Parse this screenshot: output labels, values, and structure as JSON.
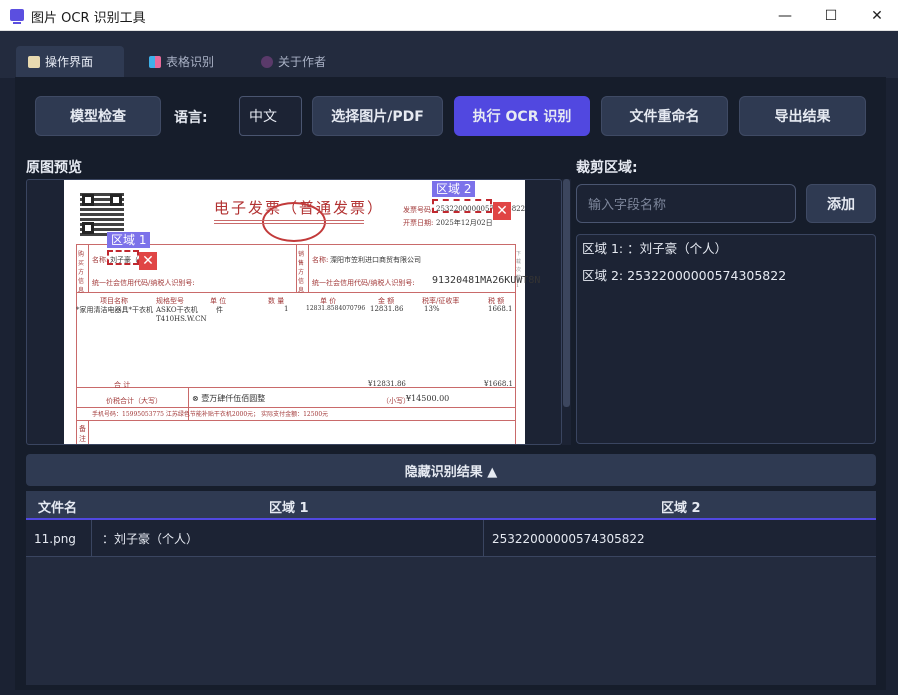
{
  "window": {
    "title": "图片 OCR 识别工具",
    "min": "—",
    "max": "☐",
    "close": "✕"
  },
  "tabs": [
    {
      "label": "操作界面",
      "icon": "clipboard-icon"
    },
    {
      "label": "表格识别",
      "icon": "table-icon"
    },
    {
      "label": "关于作者",
      "icon": "person-icon"
    }
  ],
  "toolbar": {
    "model_check": "模型检查",
    "lang_label": "语言:",
    "lang_value": "中文",
    "select_file": "选择图片/PDF",
    "run_ocr": "执行 OCR 识别",
    "rename": "文件重命名",
    "export": "导出结果"
  },
  "preview": {
    "label": "原图预览",
    "invoice": {
      "title": "电子发票（普通发票）",
      "invoice_no_label": "发票号码:",
      "invoice_no": "25322000000574305822",
      "date_label": "开票日期:",
      "date": "2025年12月02日",
      "buyer_name_label": "名称:",
      "buyer_name": "刘子豪（个人）",
      "buyer_tax_label": "统一社会信用代码/纳税人识别号:",
      "seller_name_label": "名称:",
      "seller_name": "溧阳市笠利进口商贸有限公司",
      "seller_tax_label": "统一社会信用代码/纳税人识别号:",
      "seller_tax": "91320481MA26KUWT8N",
      "buyer_side": "购买方信息",
      "seller_side": "销售方信息",
      "col_item": "项目名称",
      "col_spec": "规格型号",
      "col_unit": "单 位",
      "col_qty": "数 量",
      "col_price": "单 价",
      "col_amount": "金 额",
      "col_rate": "税率/征收率",
      "col_tax": "税 额",
      "item_name": "*家用清洁电器具*干衣机",
      "item_spec": "ASKO干衣机",
      "item_spec2": "T410HS.W.CN",
      "item_unit": "件",
      "item_qty": "1",
      "item_price": "12831.8584070796",
      "item_amount": "12831.86",
      "item_rate": "13%",
      "item_tax": "1668.1",
      "total_label": "合 计",
      "total_amount": "¥12831.86",
      "total_tax": "¥1668.1",
      "grand_label": "价税合计（大写）",
      "grand_upper": "壹万肆仟伍佰圆整",
      "grand_small_label": "（小写）",
      "grand_small": "¥14500.00",
      "remark_label": "备注",
      "remark": "手机号码：15995053775   江苏绿色节能补贴干衣机2000元；  实际支付金额：12500元",
      "side_note": "下载次数：1"
    },
    "regions": [
      {
        "tag": "区域 1"
      },
      {
        "tag": "区域 2"
      }
    ]
  },
  "crop": {
    "label": "裁剪区域:",
    "input_placeholder": "输入字段名称",
    "add_label": "添加",
    "items": [
      "区域 1: ：刘子豪（个人）",
      "区域 2: 25322000000574305822"
    ]
  },
  "toggle_label": "隐藏识别结果 ▲",
  "results": {
    "headers": [
      "文件名",
      "区域 1",
      "区域 2"
    ],
    "rows": [
      [
        "11.png",
        "：刘子豪（个人）",
        "25322000000574305822"
      ]
    ]
  },
  "colors": {
    "accent": "#5148e0",
    "panel": "#2f3a52",
    "background": "#161d2b",
    "region_tag": "#7c72ea",
    "close_red": "#e04545"
  }
}
